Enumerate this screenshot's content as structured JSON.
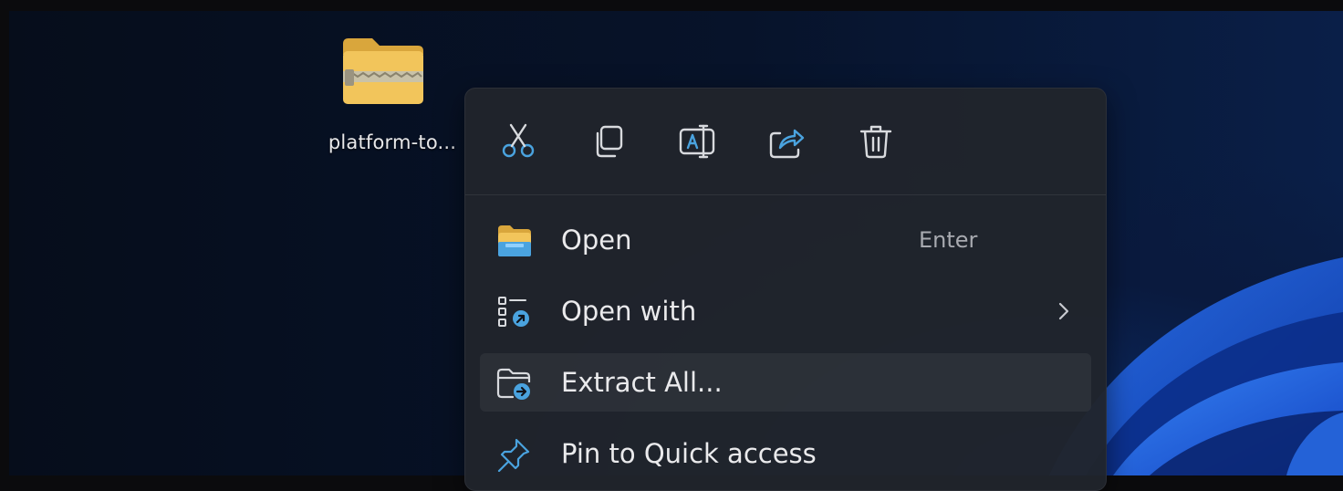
{
  "desktop": {
    "file_icon": {
      "icon": "zip-folder-icon",
      "label": "platform-to..."
    }
  },
  "context_menu": {
    "toolbar": [
      {
        "name": "cut-icon",
        "action": "Cut"
      },
      {
        "name": "copy-icon",
        "action": "Copy"
      },
      {
        "name": "rename-icon",
        "action": "Rename"
      },
      {
        "name": "share-icon",
        "action": "Share"
      },
      {
        "name": "delete-icon",
        "action": "Delete"
      }
    ],
    "items": [
      {
        "label": "Open",
        "shortcut": "Enter",
        "icon": "folder-open-icon"
      },
      {
        "label": "Open with",
        "icon": "open-with-icon",
        "submenu": true
      },
      {
        "label": "Extract All...",
        "icon": "extract-icon",
        "highlighted": true
      },
      {
        "label": "Pin to Quick access",
        "icon": "pin-icon"
      }
    ]
  },
  "colors": {
    "accent": "#4aa3df",
    "menu_bg": "#20242c",
    "folder_yellow": "#f2c55b",
    "wallpaper_blue": "#1f5fe0"
  }
}
